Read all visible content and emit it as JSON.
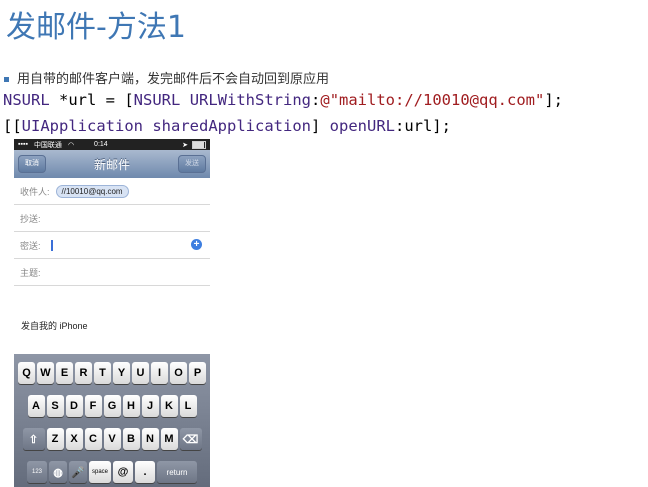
{
  "title": "发邮件-方法1",
  "bullet": "用自带的邮件客户端，发完邮件后不会自动回到原应用",
  "code": {
    "line1": [
      {
        "t": "NSURL",
        "c": "k"
      },
      {
        "t": " *url = [",
        "c": "p"
      },
      {
        "t": "NSURL",
        "c": "k"
      },
      {
        "t": " ",
        "c": "p"
      },
      {
        "t": "URLWithString",
        "c": "k"
      },
      {
        "t": ":",
        "c": "p"
      },
      {
        "t": "@\"mailto://10010@qq.com\"",
        "c": "s"
      },
      {
        "t": "];",
        "c": "p"
      }
    ],
    "line2": [
      {
        "t": "[[",
        "c": "p"
      },
      {
        "t": "UIApplication",
        "c": "k"
      },
      {
        "t": " ",
        "c": "p"
      },
      {
        "t": "sharedApplication",
        "c": "k"
      },
      {
        "t": "] ",
        "c": "p"
      },
      {
        "t": "openURL",
        "c": "k"
      },
      {
        "t": ":url];",
        "c": "p"
      }
    ]
  },
  "phone": {
    "carrier": "中国联通",
    "time": "0:14",
    "nav_title": "新邮件",
    "cancel": "取消",
    "send": "发送",
    "to_label": "收件人:",
    "to_value": "//10010@qq.com",
    "cc_label": "抄送:",
    "bcc_label": "密送:",
    "subject_label": "主题:",
    "signature": "发自我的 iPhone",
    "keys_row1": [
      "Q",
      "W",
      "E",
      "R",
      "T",
      "Y",
      "U",
      "I",
      "O",
      "P"
    ],
    "keys_row2": [
      "A",
      "S",
      "D",
      "F",
      "G",
      "H",
      "J",
      "K",
      "L"
    ],
    "keys_row3": [
      "Z",
      "X",
      "C",
      "V",
      "B",
      "N",
      "M"
    ],
    "key_123": "123",
    "key_space": "space",
    "key_at": "@",
    "key_dot": ".",
    "key_return": "return"
  },
  "colors": {
    "title": "#3f77b4",
    "keyword": "#43277f",
    "string": "#a01d20"
  }
}
